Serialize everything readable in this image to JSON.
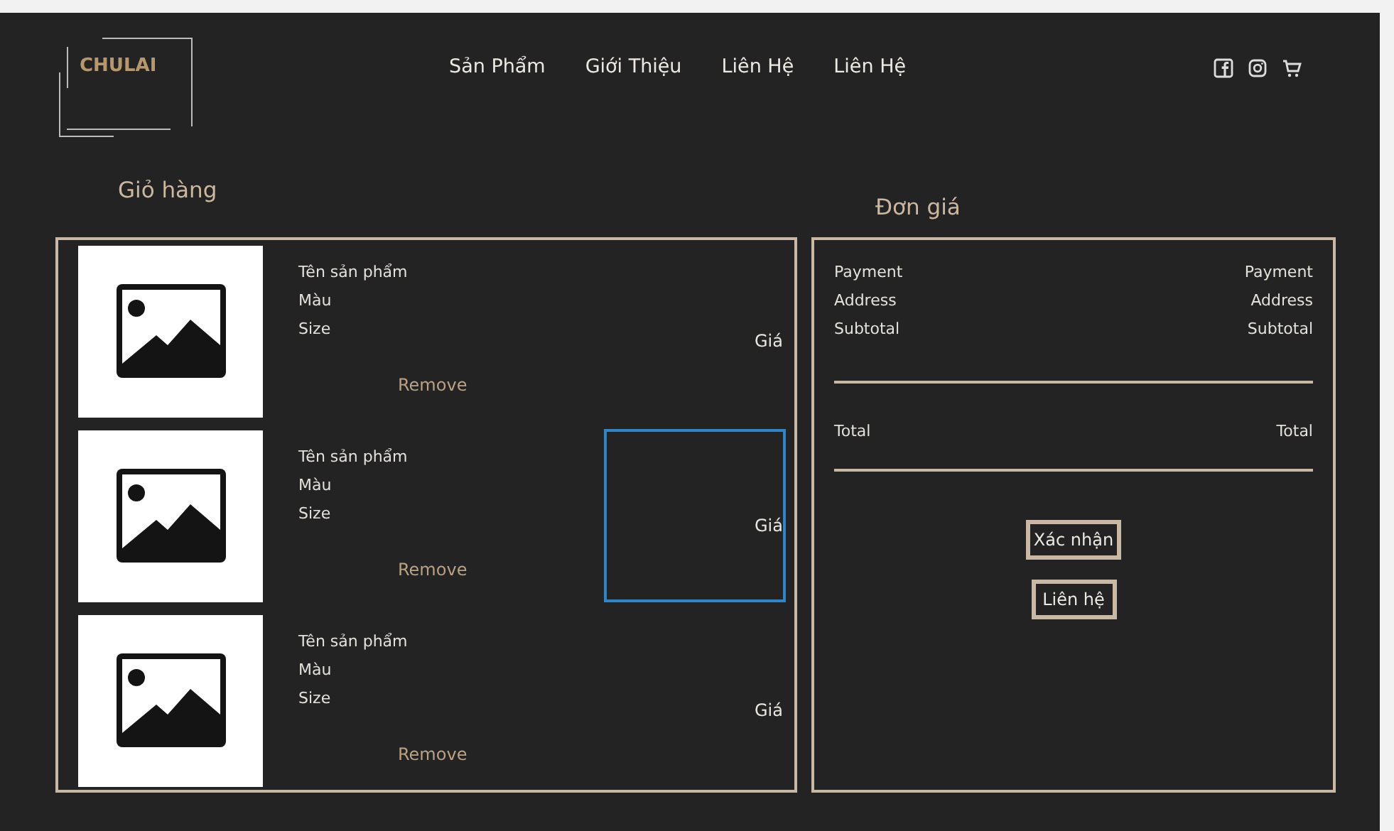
{
  "header": {
    "logo": "CHULAI",
    "nav": [
      "Sản Phẩm",
      "Giới Thiệu",
      "Liên Hệ",
      "Liên Hệ"
    ],
    "icons": [
      {
        "kind": "facebook"
      },
      {
        "kind": "instagram"
      },
      {
        "kind": "cart"
      }
    ]
  },
  "cart": {
    "title": "Giỏ hàng",
    "items": [
      {
        "name": "Tên sản phẩm",
        "variant": "Màu",
        "size": "Size",
        "remove": "Remove",
        "price": "Giá",
        "selected": false
      },
      {
        "name": "Tên sản phẩm",
        "variant": "Màu",
        "size": "Size",
        "remove": "Remove",
        "price": "Giá",
        "selected": true
      },
      {
        "name": "Tên sản phẩm",
        "variant": "Màu",
        "size": "Size",
        "remove": "Remove",
        "price": "Giá",
        "selected": false
      }
    ]
  },
  "summary": {
    "title": "Đơn giá",
    "rows": [
      {
        "label": "Payment",
        "value": "Payment"
      },
      {
        "label": "Address",
        "value": "Address"
      },
      {
        "label": "Subtotal",
        "value": "Subtotal"
      }
    ],
    "total": {
      "label": "Total",
      "value": "Total"
    },
    "buttons": [
      "Xác nhận",
      "Liên hệ"
    ]
  }
}
